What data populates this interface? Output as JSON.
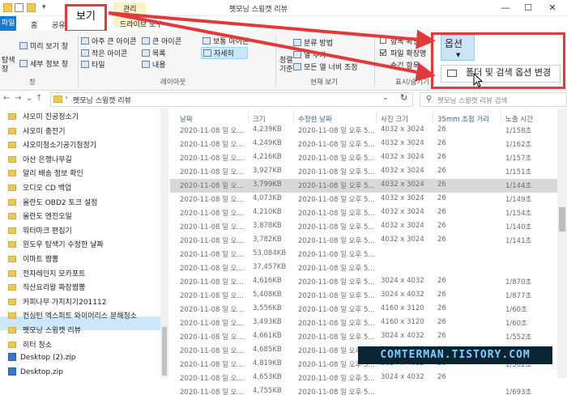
{
  "window": {
    "title": "펫모닝 스윙캣 리뷰",
    "minimize": "—",
    "maximize": "☐",
    "close": "✕"
  },
  "tabs": {
    "file": "파일",
    "home": "홈",
    "share": "공유",
    "view": "보기",
    "manage": "관리",
    "drive_tools": "드라이브 도구"
  },
  "ribbon": {
    "nav_pane": "탐색\n창",
    "preview_pane": "미리 보기 창",
    "details_pane": "세부 정보 창",
    "pane_group": "창",
    "layout_items": [
      "아주 큰 아이콘",
      "큰 아이콘",
      "보통 아이콘",
      "작은 아이콘",
      "목록",
      "자세히",
      "타일",
      "내용"
    ],
    "layout_group": "레이아웃",
    "sort_by": "정렬\n기준",
    "group_by": "분류 방법",
    "add_columns": "열 추가",
    "fit_columns": "모든 열 너비 조정",
    "current_view_group": "현재 보기",
    "item_checkboxes": "항목 확인란",
    "file_ext": "파일 확장명",
    "hidden_items": "숨긴 항목",
    "show_hide_group": "표시/숨기기",
    "options": "옵션",
    "folder_options": "폴더 및 검색 옵션 변경"
  },
  "address": {
    "path": "펫모닝 스윙캣 리뷰",
    "search_placeholder": "펫모닝 스윙캣 리뷰 검색"
  },
  "nav_items": [
    {
      "label": "샤오미 진공청소기",
      "type": "folder"
    },
    {
      "label": "샤오미 충전기",
      "type": "folder"
    },
    {
      "label": "샤오미청소기공기청정기",
      "type": "folder"
    },
    {
      "label": "아산 은행나무길",
      "type": "folder"
    },
    {
      "label": "알리 배송 정보 확인",
      "type": "folder"
    },
    {
      "label": "오디오 CD 백업",
      "type": "folder"
    },
    {
      "label": "올란도 OBD2 토크 설정",
      "type": "folder"
    },
    {
      "label": "올란도 엔진오일",
      "type": "folder"
    },
    {
      "label": "워터마크 편집기",
      "type": "folder"
    },
    {
      "label": "윈도우 탐색기 수정한 날짜",
      "type": "folder"
    },
    {
      "label": "이마트 짬뽕",
      "type": "folder"
    },
    {
      "label": "전자레인지 모카포트",
      "type": "folder"
    },
    {
      "label": "직산요리왕 짜장짬뽕",
      "type": "folder"
    },
    {
      "label": "커피나무 가지치기201112",
      "type": "folder"
    },
    {
      "label": "컨싱턴 엑스퍼트 와이어리스 분해청소",
      "type": "folder"
    },
    {
      "label": "펫모닝 스윙캣 리뷰",
      "type": "folder"
    },
    {
      "label": "히터 청소",
      "type": "folder"
    },
    {
      "label": "Desktop (2).zip",
      "type": "zip"
    },
    {
      "label": "Desktop.zip",
      "type": "zip"
    }
  ],
  "columns": [
    "날짜",
    "크기",
    "수정한 날짜",
    "사진 크기",
    "35mm 초점 거리",
    "노출 시간"
  ],
  "rows": [
    [
      "2020-11-08 일 오...",
      "4,239KB",
      "2020-11-08 일 오후 5...",
      "4032 x 3024",
      "26",
      "1/158초"
    ],
    [
      "2020-11-08 일 오...",
      "4,249KB",
      "2020-11-08 일 오후 5...",
      "4032 x 3024",
      "26",
      "1/162초"
    ],
    [
      "2020-11-08 일 오...",
      "4,216KB",
      "2020-11-08 일 오후 5...",
      "4032 x 3024",
      "26",
      "1/157초"
    ],
    [
      "2020-11-08 일 오...",
      "3,927KB",
      "2020-11-08 일 오후 5...",
      "4032 x 3024",
      "26",
      "1/151초"
    ],
    [
      "2020-11-08 일 오...",
      "3,799KB",
      "2020-11-08 일 오후 5...",
      "4032 x 3024",
      "26",
      "1/144초"
    ],
    [
      "2020-11-08 일 오...",
      "4,073KB",
      "2020-11-08 일 오후 5...",
      "4032 x 3024",
      "26",
      "1/149초"
    ],
    [
      "2020-11-08 일 오...",
      "4,210KB",
      "2020-11-08 일 오후 5...",
      "4032 x 3024",
      "26",
      "1/154초"
    ],
    [
      "2020-11-08 일 오...",
      "3,878KB",
      "2020-11-08 일 오후 5...",
      "4032 x 3024",
      "26",
      "1/140초"
    ],
    [
      "2020-11-08 일 오...",
      "3,782KB",
      "2020-11-08 일 오후 5...",
      "4032 x 3024",
      "26",
      "1/141초"
    ],
    [
      "2020-11-08 일 오...",
      "53,084KB",
      "2020-11-08 일 오후 5...",
      "",
      "",
      ""
    ],
    [
      "2020-11-08 일 오...",
      "37,457KB",
      "2020-11-08 일 오후 5...",
      "",
      "",
      ""
    ],
    [
      "2020-11-08 일 오...",
      "4,616KB",
      "2020-11-08 일 오후 5...",
      "3024 x 4032",
      "26",
      "1/870초"
    ],
    [
      "2020-11-08 일 오...",
      "5,408KB",
      "2020-11-08 일 오후 5...",
      "3024 x 4032",
      "26",
      "1/877초"
    ],
    [
      "2020-11-08 일 오...",
      "3,556KB",
      "2020-11-08 일 오후 5...",
      "4160 x 3120",
      "26",
      "1/60초"
    ],
    [
      "2020-11-08 일 오...",
      "3,493KB",
      "2020-11-08 일 오후 5...",
      "4160 x 3120",
      "26",
      "1/60초"
    ],
    [
      "2020-11-08 일 오...",
      "4,661KB",
      "2020-11-08 일 오후 5...",
      "3024 x 4032",
      "26",
      "1/552초"
    ],
    [
      "2020-11-08 일 오...",
      "4,685KB",
      "2020-11-08 일 오후 5...",
      "3024 x 4032",
      "26",
      "1/595초"
    ],
    [
      "2020-11-08 일 오...",
      "4,819KB",
      "2020-11-08 일 오후 5...",
      "3024 x 4032",
      "26",
      "1/562초"
    ],
    [
      "2020-11-08 일 오...",
      "4,653KB",
      "2020-11-08 일 오후 5...",
      "3024 x 4032",
      "26",
      ""
    ],
    [
      "2020-11-08 일 오...",
      "4,755KB",
      "2020-11-08 일 오후 5...",
      "",
      "",
      "1/693초"
    ]
  ],
  "watermark": "COMTERMAN.TISTORY.COM"
}
